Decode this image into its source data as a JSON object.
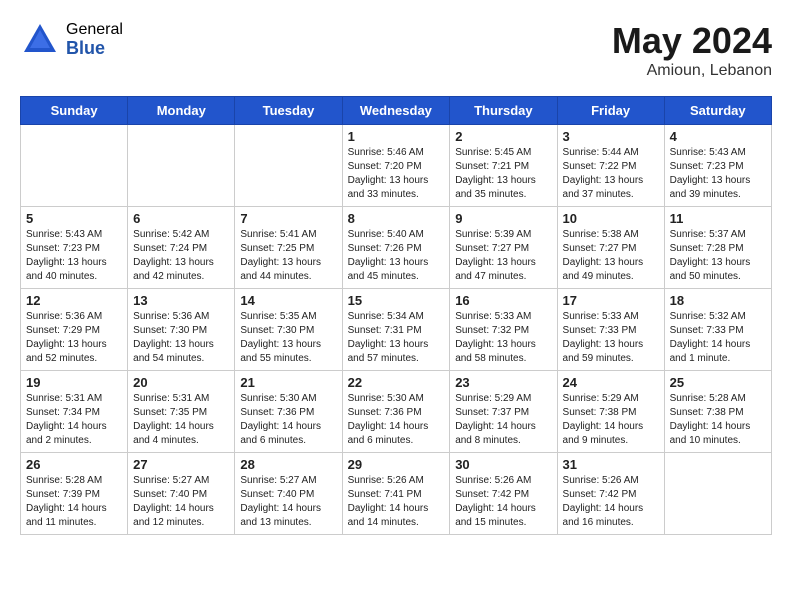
{
  "logo": {
    "general": "General",
    "blue": "Blue"
  },
  "title": "May 2024",
  "location": "Amioun, Lebanon",
  "weekdays": [
    "Sunday",
    "Monday",
    "Tuesday",
    "Wednesday",
    "Thursday",
    "Friday",
    "Saturday"
  ],
  "weeks": [
    [
      {
        "day": "",
        "info": ""
      },
      {
        "day": "",
        "info": ""
      },
      {
        "day": "",
        "info": ""
      },
      {
        "day": "1",
        "info": "Sunrise: 5:46 AM\nSunset: 7:20 PM\nDaylight: 13 hours\nand 33 minutes."
      },
      {
        "day": "2",
        "info": "Sunrise: 5:45 AM\nSunset: 7:21 PM\nDaylight: 13 hours\nand 35 minutes."
      },
      {
        "day": "3",
        "info": "Sunrise: 5:44 AM\nSunset: 7:22 PM\nDaylight: 13 hours\nand 37 minutes."
      },
      {
        "day": "4",
        "info": "Sunrise: 5:43 AM\nSunset: 7:23 PM\nDaylight: 13 hours\nand 39 minutes."
      }
    ],
    [
      {
        "day": "5",
        "info": "Sunrise: 5:43 AM\nSunset: 7:23 PM\nDaylight: 13 hours\nand 40 minutes."
      },
      {
        "day": "6",
        "info": "Sunrise: 5:42 AM\nSunset: 7:24 PM\nDaylight: 13 hours\nand 42 minutes."
      },
      {
        "day": "7",
        "info": "Sunrise: 5:41 AM\nSunset: 7:25 PM\nDaylight: 13 hours\nand 44 minutes."
      },
      {
        "day": "8",
        "info": "Sunrise: 5:40 AM\nSunset: 7:26 PM\nDaylight: 13 hours\nand 45 minutes."
      },
      {
        "day": "9",
        "info": "Sunrise: 5:39 AM\nSunset: 7:27 PM\nDaylight: 13 hours\nand 47 minutes."
      },
      {
        "day": "10",
        "info": "Sunrise: 5:38 AM\nSunset: 7:27 PM\nDaylight: 13 hours\nand 49 minutes."
      },
      {
        "day": "11",
        "info": "Sunrise: 5:37 AM\nSunset: 7:28 PM\nDaylight: 13 hours\nand 50 minutes."
      }
    ],
    [
      {
        "day": "12",
        "info": "Sunrise: 5:36 AM\nSunset: 7:29 PM\nDaylight: 13 hours\nand 52 minutes."
      },
      {
        "day": "13",
        "info": "Sunrise: 5:36 AM\nSunset: 7:30 PM\nDaylight: 13 hours\nand 54 minutes."
      },
      {
        "day": "14",
        "info": "Sunrise: 5:35 AM\nSunset: 7:30 PM\nDaylight: 13 hours\nand 55 minutes."
      },
      {
        "day": "15",
        "info": "Sunrise: 5:34 AM\nSunset: 7:31 PM\nDaylight: 13 hours\nand 57 minutes."
      },
      {
        "day": "16",
        "info": "Sunrise: 5:33 AM\nSunset: 7:32 PM\nDaylight: 13 hours\nand 58 minutes."
      },
      {
        "day": "17",
        "info": "Sunrise: 5:33 AM\nSunset: 7:33 PM\nDaylight: 13 hours\nand 59 minutes."
      },
      {
        "day": "18",
        "info": "Sunrise: 5:32 AM\nSunset: 7:33 PM\nDaylight: 14 hours\nand 1 minute."
      }
    ],
    [
      {
        "day": "19",
        "info": "Sunrise: 5:31 AM\nSunset: 7:34 PM\nDaylight: 14 hours\nand 2 minutes."
      },
      {
        "day": "20",
        "info": "Sunrise: 5:31 AM\nSunset: 7:35 PM\nDaylight: 14 hours\nand 4 minutes."
      },
      {
        "day": "21",
        "info": "Sunrise: 5:30 AM\nSunset: 7:36 PM\nDaylight: 14 hours\nand 6 minutes."
      },
      {
        "day": "22",
        "info": "Sunrise: 5:30 AM\nSunset: 7:36 PM\nDaylight: 14 hours\nand 6 minutes."
      },
      {
        "day": "23",
        "info": "Sunrise: 5:29 AM\nSunset: 7:37 PM\nDaylight: 14 hours\nand 8 minutes."
      },
      {
        "day": "24",
        "info": "Sunrise: 5:29 AM\nSunset: 7:38 PM\nDaylight: 14 hours\nand 9 minutes."
      },
      {
        "day": "25",
        "info": "Sunrise: 5:28 AM\nSunset: 7:38 PM\nDaylight: 14 hours\nand 10 minutes."
      }
    ],
    [
      {
        "day": "26",
        "info": "Sunrise: 5:28 AM\nSunset: 7:39 PM\nDaylight: 14 hours\nand 11 minutes."
      },
      {
        "day": "27",
        "info": "Sunrise: 5:27 AM\nSunset: 7:40 PM\nDaylight: 14 hours\nand 12 minutes."
      },
      {
        "day": "28",
        "info": "Sunrise: 5:27 AM\nSunset: 7:40 PM\nDaylight: 14 hours\nand 13 minutes."
      },
      {
        "day": "29",
        "info": "Sunrise: 5:26 AM\nSunset: 7:41 PM\nDaylight: 14 hours\nand 14 minutes."
      },
      {
        "day": "30",
        "info": "Sunrise: 5:26 AM\nSunset: 7:42 PM\nDaylight: 14 hours\nand 15 minutes."
      },
      {
        "day": "31",
        "info": "Sunrise: 5:26 AM\nSunset: 7:42 PM\nDaylight: 14 hours\nand 16 minutes."
      },
      {
        "day": "",
        "info": ""
      }
    ]
  ]
}
